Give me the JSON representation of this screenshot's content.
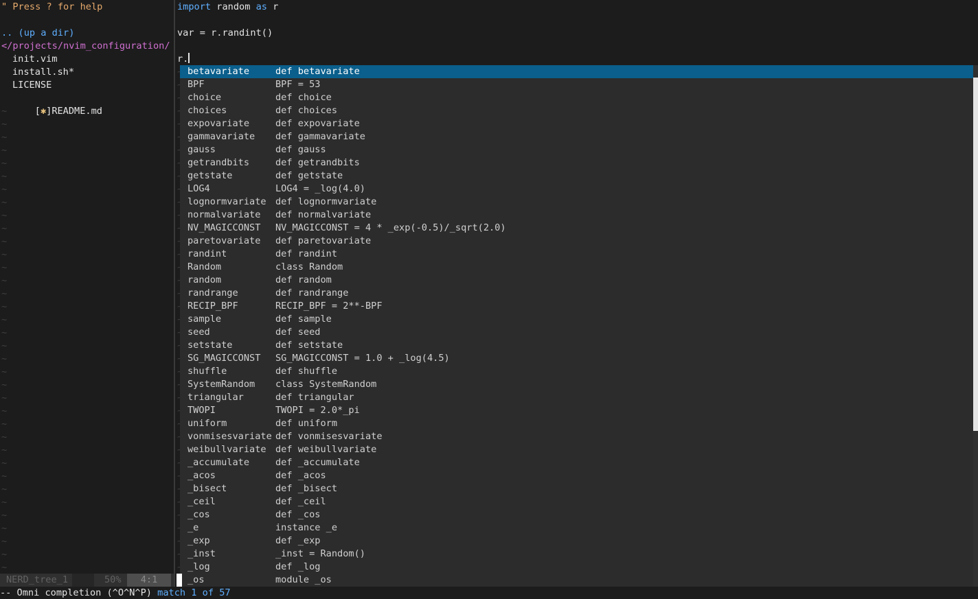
{
  "tree": {
    "help": "\" Press ? for help",
    "up_dir": ".. (up a dir)",
    "cwd": "</projects/nvim_configuration/",
    "files": [
      "init.vim",
      "install.sh*",
      "LICENSE"
    ],
    "readme_marker": "[",
    "readme_star": "✱",
    "readme_close": "]",
    "readme_name": "README.md"
  },
  "statusline": {
    "name": "NERD_tree_1",
    "percent": "50%",
    "position": "4:1"
  },
  "editor": {
    "line1_kw1": "import",
    "line1_mod": " random ",
    "line1_kw2": "as",
    "line1_alias": " r",
    "line3": "var = r.randint()",
    "line5": "r."
  },
  "completion": {
    "selected_index": 0,
    "items": [
      [
        "betavariate",
        "def betavariate"
      ],
      [
        "BPF",
        "BPF = 53"
      ],
      [
        "choice",
        "def choice"
      ],
      [
        "choices",
        "def choices"
      ],
      [
        "expovariate",
        "def expovariate"
      ],
      [
        "gammavariate",
        "def gammavariate"
      ],
      [
        "gauss",
        "def gauss"
      ],
      [
        "getrandbits",
        "def getrandbits"
      ],
      [
        "getstate",
        "def getstate"
      ],
      [
        "LOG4",
        "LOG4 = _log(4.0)"
      ],
      [
        "lognormvariate",
        "def lognormvariate"
      ],
      [
        "normalvariate",
        "def normalvariate"
      ],
      [
        "NV_MAGICCONST",
        "NV_MAGICCONST = 4 * _exp(-0.5)/_sqrt(2.0)"
      ],
      [
        "paretovariate",
        "def paretovariate"
      ],
      [
        "randint",
        "def randint"
      ],
      [
        "Random",
        "class Random"
      ],
      [
        "random",
        "def random"
      ],
      [
        "randrange",
        "def randrange"
      ],
      [
        "RECIP_BPF",
        "RECIP_BPF = 2**-BPF"
      ],
      [
        "sample",
        "def sample"
      ],
      [
        "seed",
        "def seed"
      ],
      [
        "setstate",
        "def setstate"
      ],
      [
        "SG_MAGICCONST",
        "SG_MAGICCONST = 1.0 + _log(4.5)"
      ],
      [
        "shuffle",
        "def shuffle"
      ],
      [
        "SystemRandom",
        "class SystemRandom"
      ],
      [
        "triangular",
        "def triangular"
      ],
      [
        "TWOPI",
        "TWOPI = 2.0*_pi"
      ],
      [
        "uniform",
        "def uniform"
      ],
      [
        "vonmisesvariate",
        "def vonmisesvariate"
      ],
      [
        "weibullvariate",
        "def weibullvariate"
      ],
      [
        "_accumulate",
        "def _accumulate"
      ],
      [
        "_acos",
        "def _acos"
      ],
      [
        "_bisect",
        "def _bisect"
      ],
      [
        "_ceil",
        "def _ceil"
      ],
      [
        "_cos",
        "def _cos"
      ],
      [
        "_e",
        "instance _e"
      ],
      [
        "_exp",
        "def _exp"
      ],
      [
        "_inst",
        "_inst = Random()"
      ],
      [
        "_log",
        "def _log"
      ],
      [
        "_os",
        "module _os"
      ]
    ]
  },
  "cmdline": {
    "prefix": "-- Omni completion (^O^N^P) ",
    "match_a": "match ",
    "current": "1",
    "match_b": " of ",
    "total": "57"
  },
  "colors": {
    "selection": "#0a5f8c",
    "keyword": "#5fafff",
    "help": "#e5a96b",
    "cwd": "#d070d0"
  }
}
